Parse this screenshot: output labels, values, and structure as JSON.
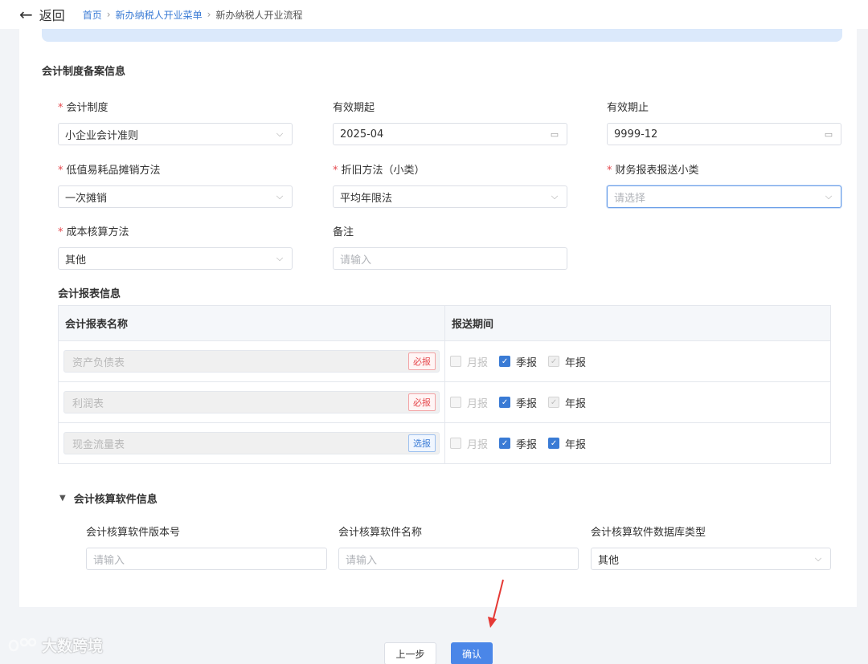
{
  "header": {
    "back_label": "返回",
    "breadcrumb": [
      "首页",
      "新办纳税人开业菜单",
      "新办纳税人开业流程"
    ]
  },
  "filing": {
    "title": "会计制度备案信息",
    "fields": {
      "system": {
        "label": "会计制度",
        "required": true,
        "value": "小企业会计准则"
      },
      "valid_from": {
        "label": "有效期起",
        "required": false,
        "value": "2025-04"
      },
      "valid_to": {
        "label": "有效期止",
        "required": false,
        "value": "9999-12"
      },
      "low_value": {
        "label": "低值易耗品摊销方法",
        "required": true,
        "value": "一次摊销"
      },
      "depreciation": {
        "label": "折旧方法（小类）",
        "required": true,
        "value": "平均年限法"
      },
      "report_type": {
        "label": "财务报表报送小类",
        "required": true,
        "placeholder": "请选择"
      },
      "cost": {
        "label": "成本核算方法",
        "required": true,
        "value": "其他"
      },
      "remark": {
        "label": "备注",
        "required": false,
        "placeholder": "请输入"
      }
    }
  },
  "reports": {
    "title": "会计报表信息",
    "col_name": "会计报表名称",
    "col_period": "报送期间",
    "period_labels": {
      "monthly": "月报",
      "quarterly": "季报",
      "annual": "年报"
    },
    "rows": [
      {
        "name": "资产负债表",
        "tag": "必报",
        "tag_color": "red",
        "monthly": false,
        "quarterly": true,
        "annual": "locked"
      },
      {
        "name": "利润表",
        "tag": "必报",
        "tag_color": "red",
        "monthly": false,
        "quarterly": true,
        "annual": "locked"
      },
      {
        "name": "现金流量表",
        "tag": "选报",
        "tag_color": "blue",
        "monthly": false,
        "quarterly": true,
        "annual": true
      }
    ]
  },
  "software": {
    "title": "会计核算软件信息",
    "version": {
      "label": "会计核算软件版本号",
      "placeholder": "请输入"
    },
    "name": {
      "label": "会计核算软件名称",
      "placeholder": "请输入"
    },
    "db_type": {
      "label": "会计核算软件数据库类型",
      "value": "其他"
    }
  },
  "footer": {
    "prev_label": "上一步",
    "confirm_label": "确认"
  },
  "watermark": "大数跨境",
  "colors": {
    "primary": "#3a7bd5",
    "required": "#e5484d",
    "arrow": "#e53935"
  }
}
